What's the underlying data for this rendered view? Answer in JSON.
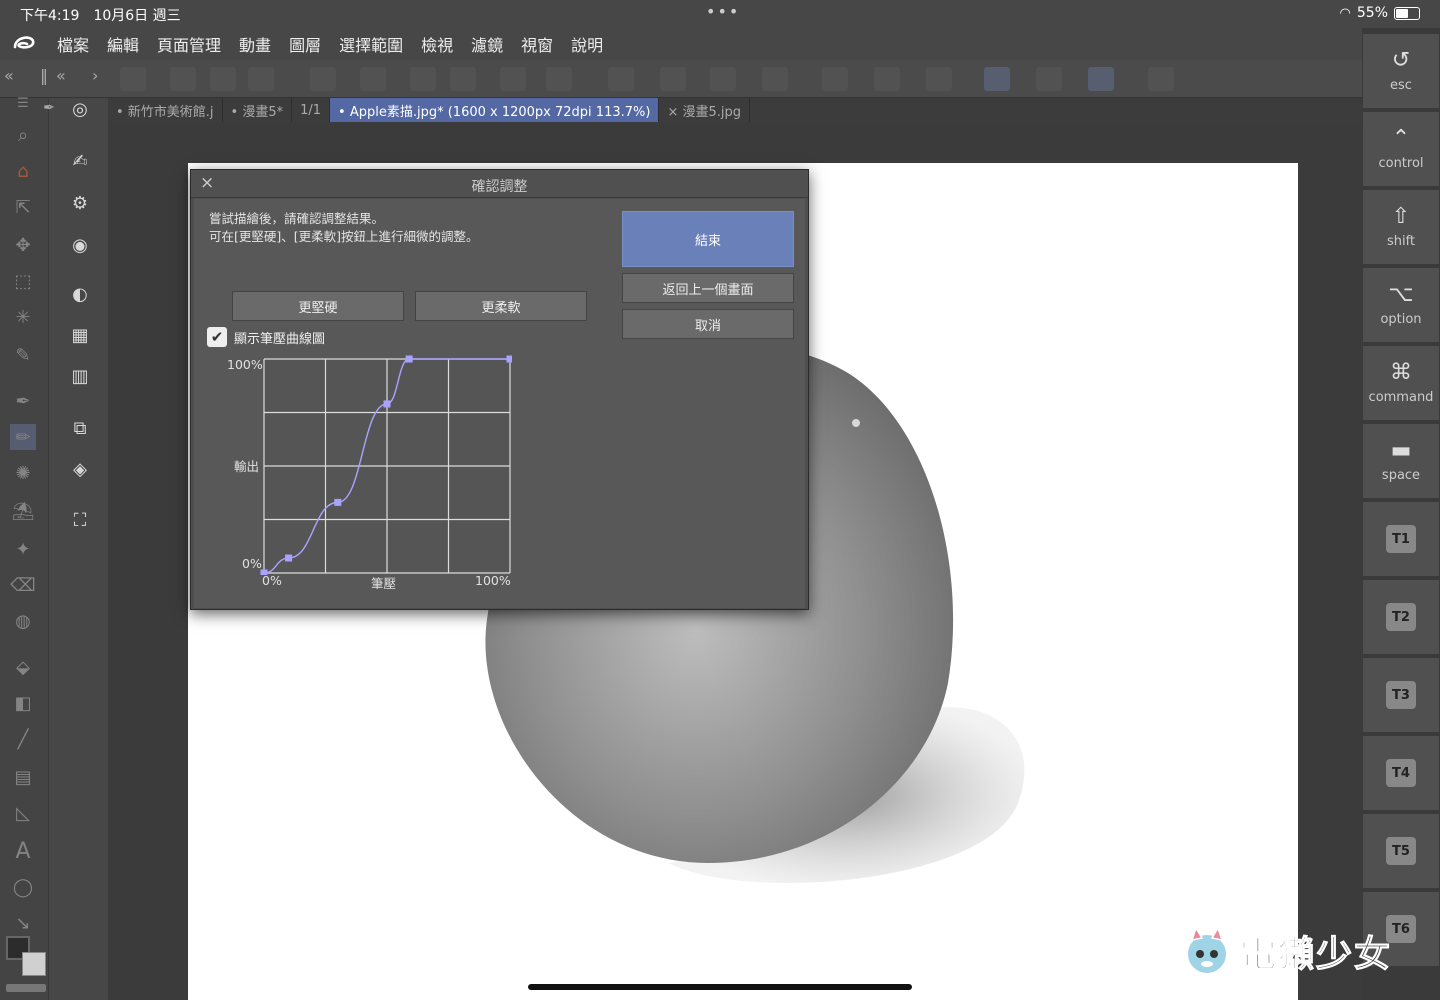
{
  "status": {
    "time": "下午4:19　10月6日 週三",
    "battery": "55%",
    "battery_level": 0.55,
    "dots": "•••"
  },
  "menu": [
    "檔案",
    "編輯",
    "頁面管理",
    "動畫",
    "圖層",
    "選擇範圍",
    "檢視",
    "濾鏡",
    "視窗",
    "說明"
  ],
  "tabs": [
    {
      "label": "• 新竹市美術館.j"
    },
    {
      "label": "• 漫畫5*"
    },
    {
      "label": "1/1"
    },
    {
      "label": "• Apple素描.jpg* (1600 x 1200px 72dpi 113.7%)"
    },
    {
      "label": "× 漫畫5.jpg"
    }
  ],
  "dialog": {
    "title": "確認調整",
    "desc1": "嘗試描繪後，請確認調整結果。",
    "desc2": "可在[更堅硬]、[更柔軟]按鈕上進行細微的調整。",
    "btn_finish": "結束",
    "btn_back": "返回上一個畫面",
    "btn_cancel": "取消",
    "btn_harder": "更堅硬",
    "btn_softer": "更柔軟",
    "checkbox_label": "顯示筆壓曲線圖",
    "checkbox_checked": true,
    "graph": {
      "y_top": "100%",
      "y_mid": "輸出",
      "y_bottom": "0%",
      "x_left": "0%",
      "x_mid": "筆壓",
      "x_right": "100%",
      "curve_points": [
        [
          0,
          0
        ],
        [
          0.1,
          0.07
        ],
        [
          0.3,
          0.33
        ],
        [
          0.5,
          0.79
        ],
        [
          0.59,
          1.0
        ],
        [
          1.0,
          1.0
        ]
      ]
    }
  },
  "keys": [
    {
      "glyph": "↺",
      "label": "esc"
    },
    {
      "glyph": "⌃",
      "label": "control"
    },
    {
      "glyph": "⇧",
      "label": "shift"
    },
    {
      "glyph": "⌥",
      "label": "option"
    },
    {
      "glyph": "⌘",
      "label": "command"
    },
    {
      "glyph": "▬",
      "label": "space"
    },
    {
      "glyph": "",
      "label": "T1"
    },
    {
      "glyph": "",
      "label": "T2"
    },
    {
      "glyph": "",
      "label": "T3"
    },
    {
      "glyph": "",
      "label": "T4"
    },
    {
      "glyph": "",
      "label": "T5"
    },
    {
      "glyph": "",
      "label": "T6"
    }
  ],
  "watermark": "電獺少女",
  "colors": {
    "accent": "#5468a4",
    "primary_button": "#6a80b8",
    "curve": "#a9a3ff"
  }
}
